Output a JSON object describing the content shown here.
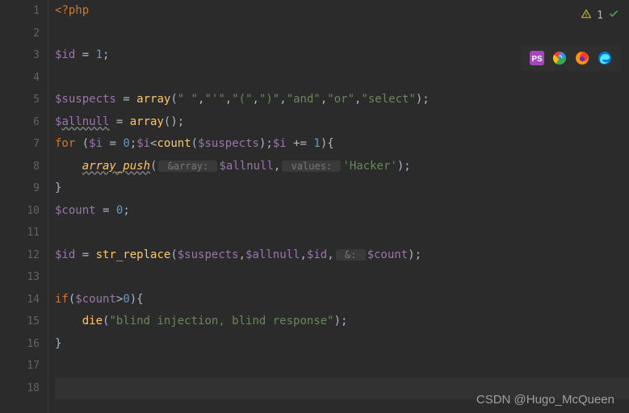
{
  "lines": [
    1,
    2,
    3,
    4,
    5,
    6,
    7,
    8,
    9,
    10,
    11,
    12,
    13,
    14,
    15,
    16,
    17,
    18
  ],
  "code": {
    "l1": {
      "php_open": "<?php"
    },
    "l3": {
      "var": "$id",
      "eq": " = ",
      "val": "1",
      "semi": ";"
    },
    "l5": {
      "var": "$suspects",
      "eq": " = ",
      "fn": "array",
      "open": "(",
      "s1": "\" \"",
      "c": ",",
      "s2": "\"'\"",
      "s3": "\"(\"",
      "s4": "\")\"",
      "s5": "\"and\"",
      "s6": "\"or\"",
      "s7": "\"select\"",
      "close": ");"
    },
    "l6": {
      "var": "$",
      "varwavy": "allnull",
      "eq": " = ",
      "fn": "array",
      "paren": "();"
    },
    "l7": {
      "for": "for",
      "open": " (",
      "iv": "$i",
      "eq": " = ",
      "z": "0",
      "semi": ";",
      "iv2": "$i",
      "lt": "<",
      "count": "count",
      "op2": "(",
      "susp": "$suspects",
      "cp2": ");",
      "iv3": "$i",
      "pe": " += ",
      "one": "1",
      "close": "){"
    },
    "l8": {
      "indent": "    ",
      "fn": "array_push",
      "open": "(",
      "hint1": " &array: ",
      "var1": "$allnull",
      "comma": ",",
      "hint2": " values: ",
      "str": "'Hacker'",
      "close": ");"
    },
    "l9": {
      "brace": "}"
    },
    "l10": {
      "var": "$count",
      "eq": " = ",
      "val": "0",
      "semi": ";"
    },
    "l12": {
      "var": "$id",
      "eq": " = ",
      "fn": "str_replace",
      "open": "(",
      "a1": "$suspects",
      "c": ",",
      "a2": "$allnull",
      "a3": "$id",
      "comma2": ",",
      "hint": " &: ",
      "a4": "$count",
      "close": ");"
    },
    "l14": {
      "if": "if",
      "open": "(",
      "var": "$count",
      "gt": ">",
      "z": "0",
      "close": "){"
    },
    "l15": {
      "indent": "    ",
      "fn": "die",
      "open": "(",
      "str": "\"blind injection, blind response\"",
      "close": ");"
    },
    "l16": {
      "brace": "}"
    }
  },
  "status": {
    "warning_count": "1"
  },
  "watermark": "CSDN @Hugo_McQueen",
  "icons": {
    "phpstorm": "phpstorm-icon",
    "chrome": "chrome-icon",
    "firefox": "firefox-icon",
    "edge": "edge-icon"
  }
}
